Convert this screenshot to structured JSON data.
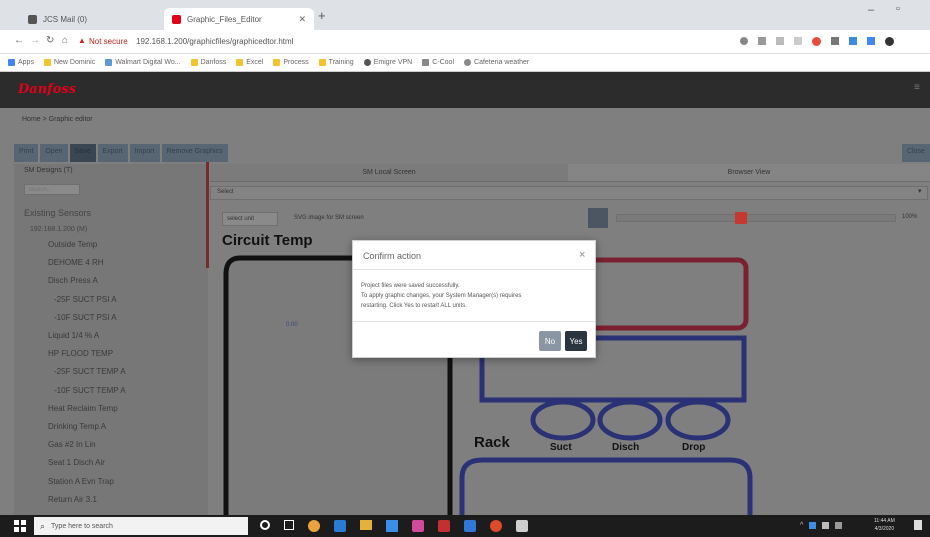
{
  "browser": {
    "tabs": [
      {
        "title": "JCS Mail (0)",
        "icon": "app-icon",
        "color": "#555555"
      },
      {
        "title": "Graphic_Files_Editor",
        "icon": "danfoss-icon",
        "color": "#e2001a"
      }
    ],
    "new_tab": "+",
    "security": "Not secure",
    "url": "192.168.1.200/graphicfiles/graphicedtor.html",
    "bookmarks": [
      "Apps",
      "New Dominic",
      "Walmart Digital Wo...",
      "Danfoss",
      "Excel",
      "Process",
      "Training",
      "Emigre VPN",
      "C-Cool",
      "Cafeteria weather"
    ]
  },
  "app": {
    "breadcrumb": "Home > Graphic editor",
    "toolbar": [
      "Print",
      "Open",
      "Save",
      "Export",
      "Import",
      "Remove Graphics"
    ],
    "toolbar_right": "Close",
    "panel_header": "SM Designs (T)",
    "search_placeholder": "Search...",
    "tree_root": "Existing Sensors",
    "tree_node": "192.168.1.200 (M)",
    "sensors": [
      "Outside Temp",
      "DEHOME 4 RH",
      "Disch Press A",
      "-25F SUCT PSI A",
      "-10F SUCT PSI A",
      "Liquid 1/4 % A",
      "HP FLOOD TEMP",
      "-25F SUCT TEMP A",
      "-10F SUCT TEMP A",
      "Heat Reclaim Temp",
      "Drinking Temp A",
      "Gas #2 In Lin",
      "Seat 1 Disch Air",
      "Station A Evn Trap",
      "Return Air 3.1"
    ],
    "col_headers": [
      "SM Local Screen",
      "Browser View"
    ],
    "select_value": "Select",
    "unit_select": "select unit",
    "image_label": "SVG image for SM screen",
    "zoom_text": "100%",
    "canvas_title": "Circuit Temp",
    "canvas_small": "0.00",
    "rack_label": "Rack",
    "circle_labels": [
      "Suct",
      "Disch",
      "Drop"
    ]
  },
  "modal": {
    "title": "Confirm action",
    "close": "×",
    "line1": "Project files were saved successfully.",
    "line2": "To apply graphic changes, your System Manager(s) requires",
    "line3": "restarting. Click Yes to restart ALL units.",
    "no": "No",
    "yes": "Yes"
  },
  "taskbar": {
    "search_placeholder": "Type here to search",
    "time": "11:44 AM",
    "date": "4/3/2020"
  },
  "colors": {
    "brand_red": "#e2001a",
    "rack_blue": "#2432a8",
    "rack_red": "#c8102e",
    "slider_red": "#e23b2e"
  }
}
